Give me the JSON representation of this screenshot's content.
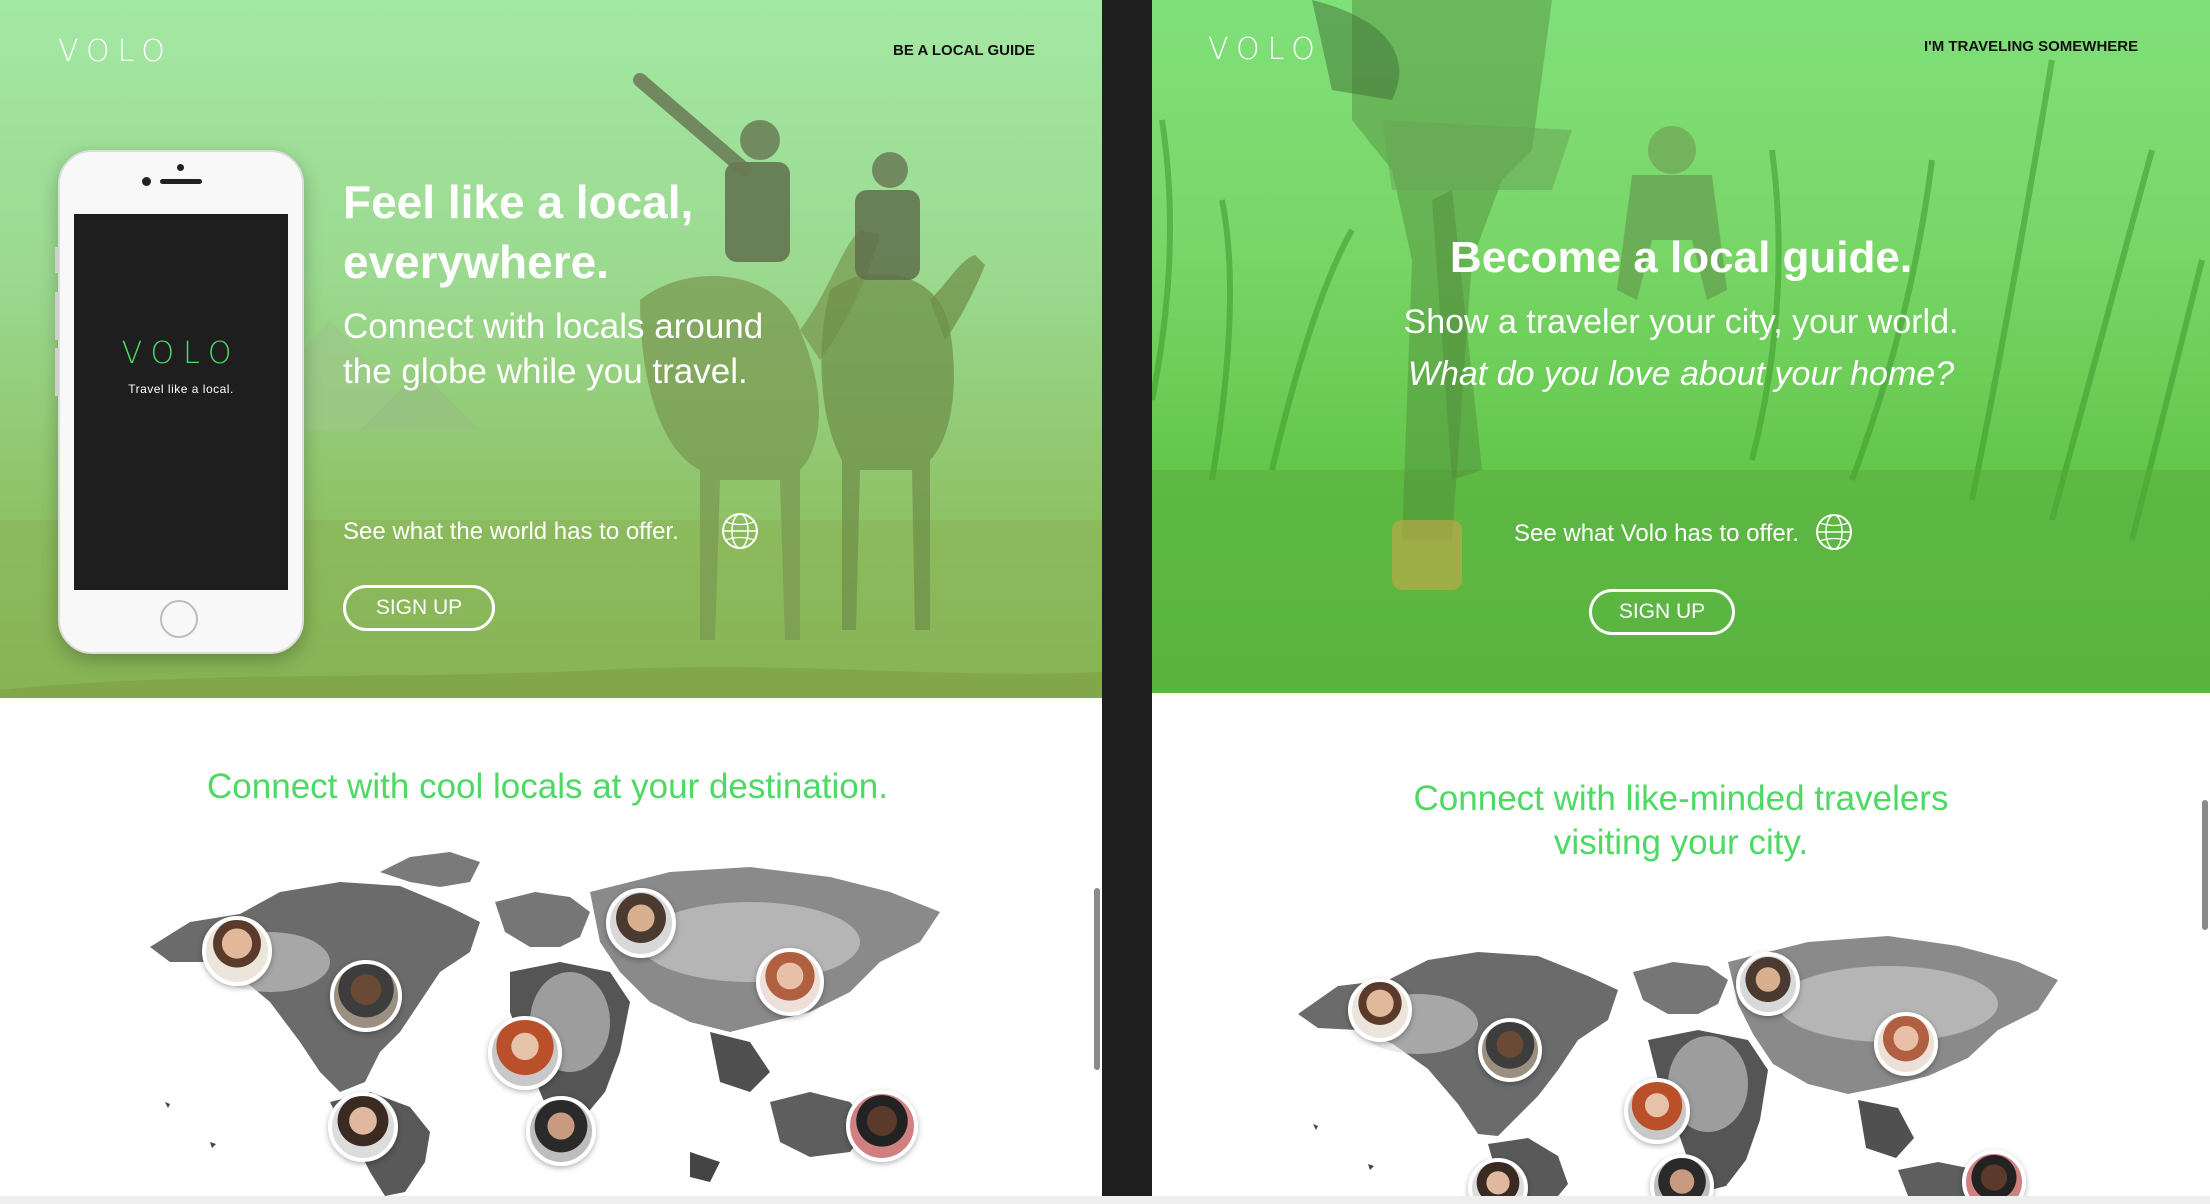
{
  "left": {
    "logo": "VOLO",
    "top_link": "BE A LOCAL GUIDE",
    "headline_line1": "Feel like a local,",
    "headline_line2": "everywhere.",
    "sub_line1": "Connect with locals around",
    "sub_line2": "the globe while you travel.",
    "tagline": "See what the world has to offer.",
    "signup_label": "SIGN UP",
    "phone": {
      "logo": "VOLO",
      "tagline": "Travel like a local."
    },
    "section_title": "Connect with cool locals at your destination."
  },
  "right": {
    "logo": "VOLO",
    "top_link": "I'M TRAVELING SOMEWHERE",
    "headline": "Become a local guide.",
    "sub_line1": "Show a traveler your city, your world.",
    "sub_line2": "What do you love about your home?",
    "tagline": "See what Volo has to offer.",
    "signup_label": "SIGN UP",
    "section_title_line1": "Connect with like-minded travelers",
    "section_title_line2": "visiting your city."
  },
  "colors": {
    "accent_green": "#4cd964",
    "hero_green": "#8fcf78",
    "divider": "#1e1e1e"
  },
  "icons": [
    "globe-icon",
    "world-map",
    "profile-avatar"
  ]
}
